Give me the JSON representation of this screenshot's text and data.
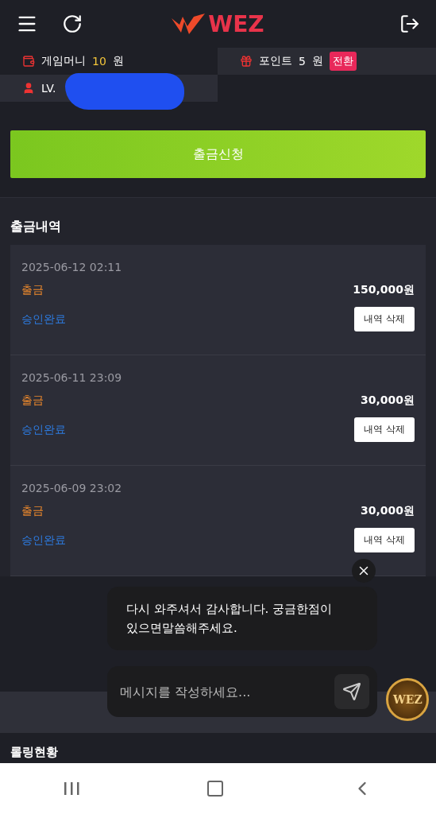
{
  "header": {
    "logo": "WEZ"
  },
  "wallet": {
    "money_label": "게임머니",
    "money_value": "10",
    "money_unit": "원",
    "point_label": "포인트",
    "point_value": "5",
    "point_unit": "원",
    "convert_button": "전환",
    "level": "LV."
  },
  "withdraw_button": "출금신청",
  "history": {
    "title": "출금내역",
    "items": [
      {
        "date": "2025-06-12 02:11",
        "type": "출금",
        "amount": "150,000원",
        "status": "승인완료",
        "action": "내역 삭제"
      },
      {
        "date": "2025-06-11 23:09",
        "type": "출금",
        "amount": "30,000원",
        "status": "승인완료",
        "action": "내역 삭제"
      },
      {
        "date": "2025-06-09 23:02",
        "type": "출금",
        "amount": "30,000원",
        "status": "승인완료",
        "action": "내역 삭제"
      }
    ]
  },
  "chat": {
    "message": "다시 와주셔서 감사합니다. 궁금한점이 있으면말씀해주세요.",
    "placeholder": "메시지를 작성하세요...",
    "badge": "WEZ"
  },
  "next_section": {
    "title": "롤링현황"
  }
}
